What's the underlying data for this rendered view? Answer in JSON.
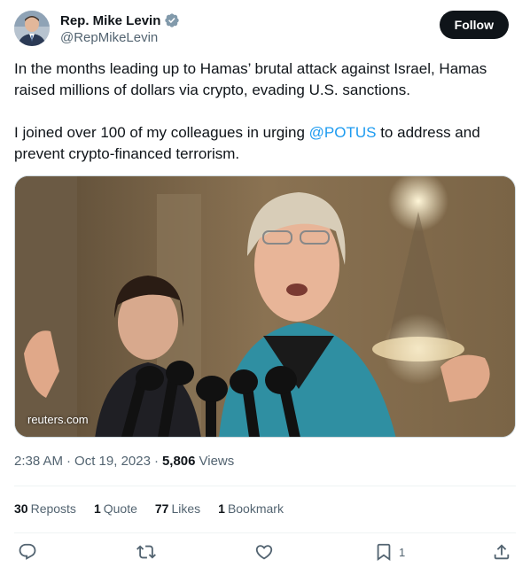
{
  "author": {
    "name": "Rep. Mike Levin",
    "handle": "@RepMikeLevin",
    "verified": true,
    "follow_label": "Follow"
  },
  "tweet": {
    "paragraph1": "In the months leading up to Hamas’ brutal attack against Israel, Hamas raised millions of dollars via crypto, evading U.S. sanctions.",
    "paragraph2_before": "I joined over 100 of my colleagues in urging ",
    "paragraph2_mention": "@POTUS",
    "paragraph2_after": " to address and prevent crypto-financed terrorism."
  },
  "media": {
    "source": "reuters.com"
  },
  "meta": {
    "time": "2:38 AM",
    "separator1": "·",
    "date": "Oct 19, 2023",
    "separator2": "·",
    "views_count": "5,806",
    "views_label": "Views"
  },
  "stats": {
    "reposts_count": "30",
    "reposts_label": "Reposts",
    "quote_count": "1",
    "quote_label": "Quote",
    "likes_count": "77",
    "likes_label": "Likes",
    "bookmark_count": "1",
    "bookmark_label": "Bookmark"
  },
  "actions": {
    "bookmark_count": "1"
  },
  "colors": {
    "accent": "#1d9bf0",
    "text": "#0f1419",
    "secondary": "#536471",
    "follow_bg": "#0f1419"
  },
  "icons": [
    "verified-badge-icon",
    "reply-icon",
    "repost-icon",
    "like-icon",
    "bookmark-icon",
    "share-icon"
  ]
}
